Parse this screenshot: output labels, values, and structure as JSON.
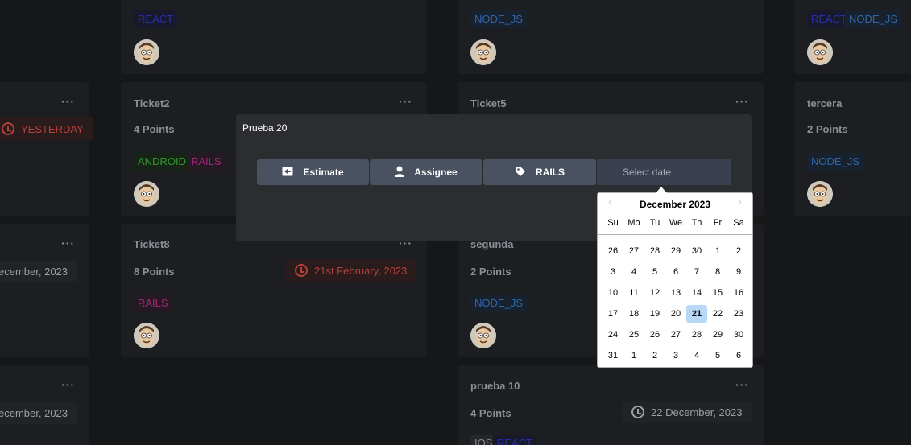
{
  "cards": {
    "c1": {
      "dots": "···",
      "date": "YESTERDAY"
    },
    "c2": {
      "dots": "···",
      "date": "ecember, 2023"
    },
    "c3": {
      "dots": "···",
      "date": "ecember, 2023"
    },
    "react_top": {
      "tag": "REACT"
    },
    "ticket2": {
      "title": "Ticket2",
      "points": "4 Points",
      "tags": [
        "ANDROID",
        "RAILS"
      ],
      "dots": "···"
    },
    "ticket8": {
      "title": "Ticket8",
      "points": "8 Points",
      "tags": [
        "RAILS"
      ],
      "date": "21st February, 2023",
      "dots": "···"
    },
    "node_top": {
      "tag": "NODE_JS"
    },
    "ticket5": {
      "title": "Ticket5",
      "dots": "···"
    },
    "segunda": {
      "title": "segunda",
      "points": "2 Points",
      "tags": [
        "NODE_JS"
      ],
      "dots": "···"
    },
    "prueba10": {
      "title": "prueba 10",
      "points": "4 Points",
      "tags": [
        "IOS",
        "REACT"
      ],
      "date": "22 December, 2023",
      "dots": "···"
    },
    "right_top": {
      "tags": [
        "REACT",
        "NODE_JS"
      ]
    },
    "tercera": {
      "title": "tercera",
      "points": "2 Points",
      "tags": [
        "NODE_JS"
      ]
    }
  },
  "modal": {
    "title": "Prueba 20",
    "buttons": {
      "estimate": "Estimate",
      "assignee": "Assignee",
      "label": "RAILS"
    },
    "date_placeholder": "Select date"
  },
  "datepicker": {
    "month": "December 2023",
    "prev": "‹",
    "next": "›",
    "weekdays": [
      "Su",
      "Mo",
      "Tu",
      "We",
      "Th",
      "Fr",
      "Sa"
    ],
    "weeks": [
      [
        "26",
        "27",
        "28",
        "29",
        "30",
        "1",
        "2"
      ],
      [
        "3",
        "4",
        "5",
        "6",
        "7",
        "8",
        "9"
      ],
      [
        "10",
        "11",
        "12",
        "13",
        "14",
        "15",
        "16"
      ],
      [
        "17",
        "18",
        "19",
        "20",
        "21",
        "22",
        "23"
      ],
      [
        "24",
        "25",
        "26",
        "27",
        "28",
        "29",
        "30"
      ],
      [
        "31",
        "1",
        "2",
        "3",
        "4",
        "5",
        "6"
      ]
    ],
    "selected": "21"
  },
  "colors": {
    "accent": "#4a5160",
    "selected_day": "#b8d8f8",
    "date_red": "#b3413a"
  },
  "icons": {
    "estimate": "arrow-left-box-icon",
    "assignee": "user-icon",
    "label": "tag-icon",
    "date": "clock-icon"
  }
}
